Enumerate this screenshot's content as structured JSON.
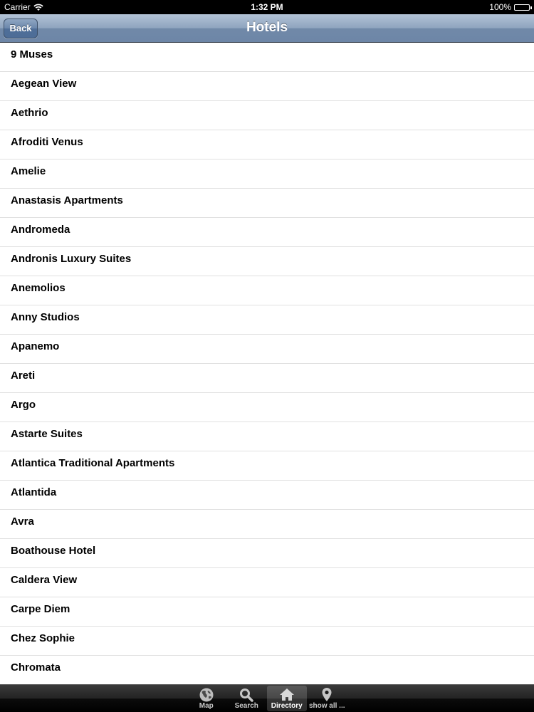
{
  "status_bar": {
    "carrier": "Carrier",
    "time": "1:32 PM",
    "battery": "100%",
    "wifi_icon": "wifi-icon",
    "battery_icon": "battery-icon"
  },
  "nav": {
    "title": "Hotels",
    "back_label": "Back"
  },
  "hotels": [
    "9 Muses",
    "Aegean View",
    "Aethrio",
    "Afroditi Venus",
    "Amelie",
    "Anastasis Apartments",
    "Andromeda",
    "Andronis Luxury Suites",
    "Anemolios",
    "Anny Studios",
    "Apanemo",
    "Areti",
    "Argo",
    "Astarte Suites",
    "Atlantica Traditional Apartments",
    "Atlantida",
    "Avra",
    "Boathouse Hotel",
    "Caldera View",
    "Carpe Diem",
    "Chez Sophie",
    "Chromata"
  ],
  "tab_bar": {
    "tabs": [
      {
        "label": "Map",
        "icon": "globe-icon",
        "active": false
      },
      {
        "label": "Search",
        "icon": "search-icon",
        "active": false
      },
      {
        "label": "Directory",
        "icon": "home-icon",
        "active": true
      },
      {
        "label": "show all ...",
        "icon": "map-pin-icon",
        "active": false
      }
    ]
  },
  "colors": {
    "nav_bar": "#7f97b6",
    "tab_bar": "#1a1a1a",
    "row_divider": "#e0e0e0"
  }
}
